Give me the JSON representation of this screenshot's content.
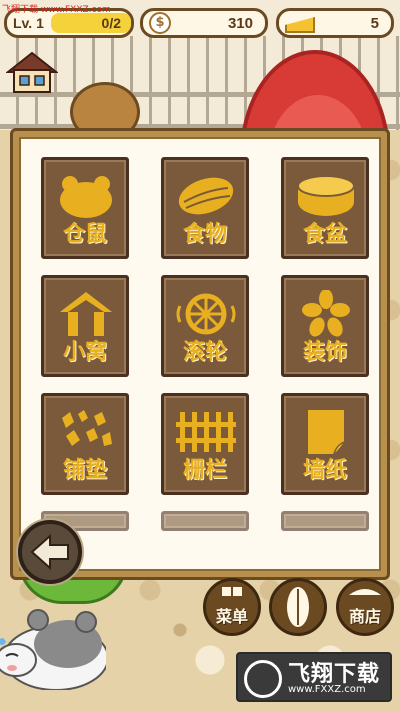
{
  "watermark": "飞翔下载 www.FXXZ.com",
  "hud": {
    "level_label": "Lv. 1",
    "xp_text": "0/2",
    "xp_fraction": 0,
    "coins": "310",
    "cheese": "5"
  },
  "menu": {
    "tiles": [
      {
        "label": "仓鼠",
        "icon": "hamster-face-icon"
      },
      {
        "label": "食物",
        "icon": "seed-icon"
      },
      {
        "label": "食盆",
        "icon": "bowl-icon"
      },
      {
        "label": "小窝",
        "icon": "house-icon"
      },
      {
        "label": "滚轮",
        "icon": "wheel-icon"
      },
      {
        "label": "装饰",
        "icon": "flower-icon"
      },
      {
        "label": "铺垫",
        "icon": "bedding-icon"
      },
      {
        "label": "栅栏",
        "icon": "fence-icon"
      },
      {
        "label": "墙纸",
        "icon": "wallpaper-icon"
      }
    ]
  },
  "bottom_nav": {
    "menu_label": "菜单",
    "shop_label": "商店"
  },
  "logo": {
    "title": "飞翔下载",
    "url": "www.FXXZ.com"
  },
  "colors": {
    "tile_bg": "#7a5a3a",
    "tile_icon": "#e8b020",
    "panel_frame": "#b8904e",
    "wheel": "#d83a36"
  }
}
